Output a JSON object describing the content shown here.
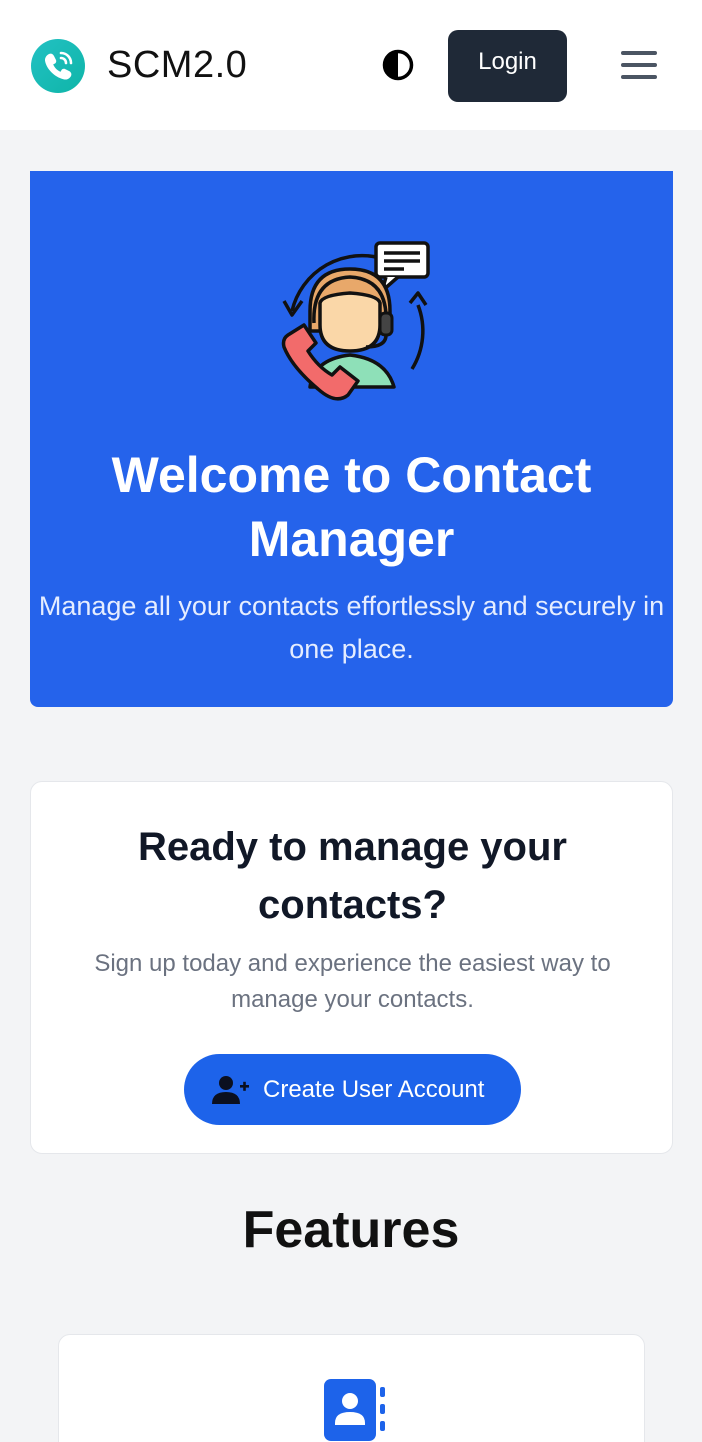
{
  "header": {
    "brand_name": "SCM2.0",
    "logo_icon": "phone-call-logo",
    "theme_toggle_icon": "half-circle-contrast-icon",
    "login_label": "Login",
    "menu_icon": "hamburger-menu-icon"
  },
  "hero": {
    "illustration": "customer-support-agent-icon",
    "title": "Welcome to Contact Manager",
    "subtitle": "Manage all your contacts effortlessly and securely in one place.",
    "background_color": "#2563eb"
  },
  "cta": {
    "title": "Ready to manage your contacts?",
    "text": "Sign up today and experience the easiest way to manage your contacts.",
    "button_icon": "user-plus-icon",
    "button_label": "Create User Account",
    "button_color": "#1d63ea"
  },
  "features": {
    "heading": "Features",
    "cards": [
      {
        "icon": "address-book-icon"
      }
    ]
  }
}
